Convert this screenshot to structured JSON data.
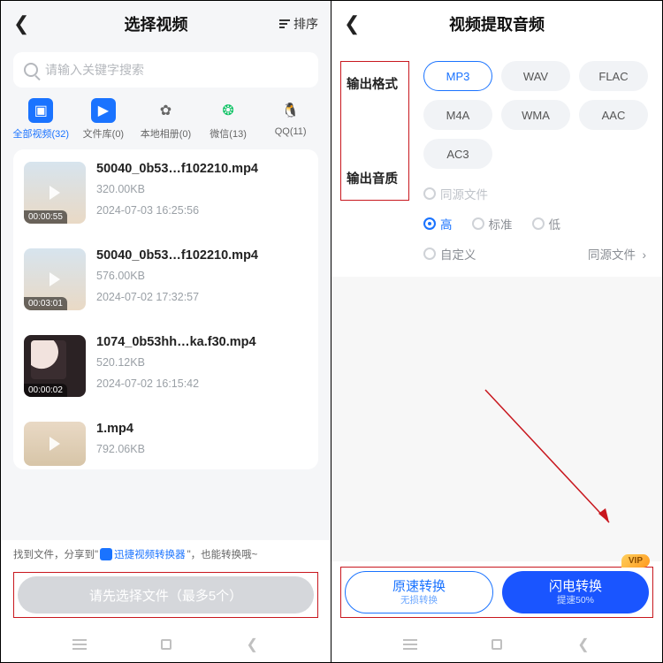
{
  "left": {
    "title": "选择视频",
    "sort_label": "排序",
    "search_placeholder": "请输入关键字搜索",
    "cats": [
      {
        "label": "全部视频(32)"
      },
      {
        "label": "文件库(0)"
      },
      {
        "label": "本地相册(0)"
      },
      {
        "label": "微信(13)"
      },
      {
        "label": "QQ(11)"
      }
    ],
    "files": [
      {
        "name": "50040_0b53…f102210.mp4",
        "size": "320.00KB",
        "date": "2024-07-03 16:25:56",
        "dur": "00:00:55"
      },
      {
        "name": "50040_0b53…f102210.mp4",
        "size": "576.00KB",
        "date": "2024-07-02 17:32:57",
        "dur": "00:03:01"
      },
      {
        "name": "1074_0b53hh…ka.f30.mp4",
        "size": "520.12KB",
        "date": "2024-07-02 16:15:42",
        "dur": "00:00:02"
      },
      {
        "name": "1.mp4",
        "size": "792.06KB",
        "date": "",
        "dur": ""
      }
    ],
    "tip_a": "找到文件，分享到\"",
    "tip_app": "迅捷视频转换器",
    "tip_b": "\"，也能转换哦~",
    "main_btn": "请先选择文件（最多5个）"
  },
  "right": {
    "title": "视频提取音频",
    "format_label": "输出格式",
    "formats": [
      "MP3",
      "WAV",
      "FLAC",
      "M4A",
      "WMA",
      "AAC",
      "AC3"
    ],
    "quality_label": "输出音质",
    "qual_src": "同源文件",
    "qual_hi": "高",
    "qual_std": "标准",
    "qual_low": "低",
    "qual_custom": "自定义",
    "qual_srcfile": "同源文件",
    "vip": "VIP",
    "btn1_t": "原速转换",
    "btn1_s": "无损转换",
    "btn2_t": "闪电转换",
    "btn2_s": "提速50%"
  }
}
